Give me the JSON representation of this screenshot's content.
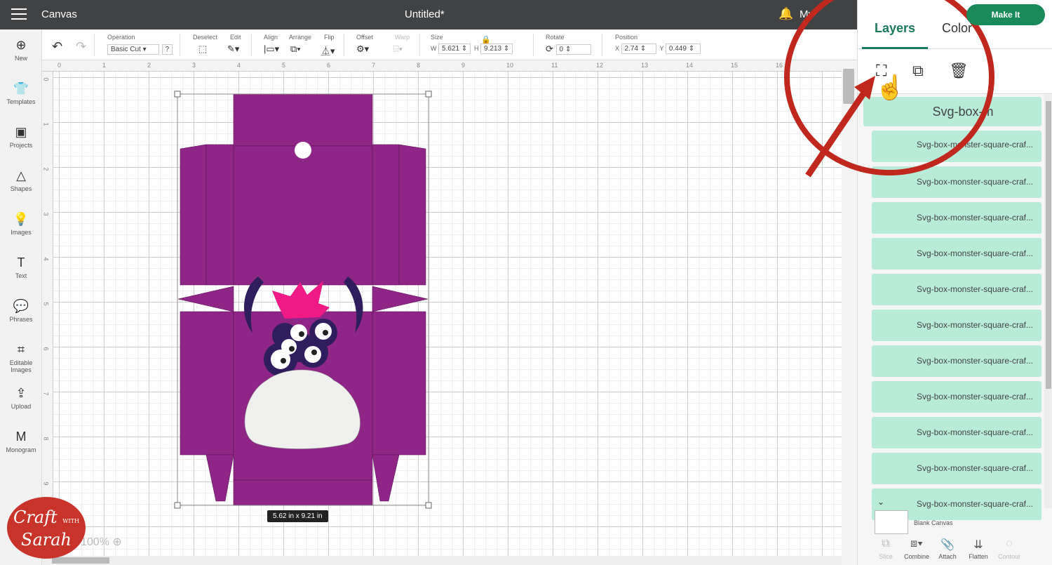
{
  "topbar": {
    "app": "Canvas",
    "title": "Untitled*",
    "my": "My",
    "make_it": "Make It"
  },
  "sidebar": [
    {
      "icon": "⊕",
      "label": "New",
      "name": "new"
    },
    {
      "icon": "👕",
      "label": "Templates",
      "name": "templates"
    },
    {
      "icon": "▣",
      "label": "Projects",
      "name": "projects"
    },
    {
      "icon": "△",
      "label": "Shapes",
      "name": "shapes"
    },
    {
      "icon": "💡",
      "label": "Images",
      "name": "images"
    },
    {
      "icon": "T",
      "label": "Text",
      "name": "text"
    },
    {
      "icon": "💬",
      "label": "Phrases",
      "name": "phrases"
    },
    {
      "icon": "⌗",
      "label": "Editable Images",
      "name": "editable-images"
    },
    {
      "icon": "⇪",
      "label": "Upload",
      "name": "upload"
    },
    {
      "icon": "M",
      "label": "Monogram",
      "name": "monogram"
    }
  ],
  "toolbar": {
    "operation_label": "Operation",
    "operation_value": "Basic Cut",
    "help": "?",
    "deselect": "Deselect",
    "edit": "Edit",
    "align": "Align",
    "arrange": "Arrange",
    "flip": "Flip",
    "offset": "Offset",
    "warp": "Warp",
    "size": "Size",
    "w_label": "W",
    "w": "5.621",
    "h_label": "H",
    "h": "9.213",
    "rotate": "Rotate",
    "rotate_value": "0",
    "position": "Position",
    "x_label": "X",
    "x": "2.74",
    "y_label": "Y",
    "y": "0.449"
  },
  "ruler_h": [
    "0",
    "1",
    "2",
    "3",
    "4",
    "5",
    "6",
    "7",
    "8",
    "9",
    "10",
    "11",
    "12",
    "13",
    "14",
    "15",
    "16"
  ],
  "ruler_v": [
    "0",
    "1",
    "2",
    "3",
    "4",
    "5",
    "6",
    "7",
    "8",
    "9"
  ],
  "size_label": "5.62  in x 9.21  in",
  "zoom": "100%",
  "panel": {
    "tabs": [
      "Layers",
      "Color"
    ],
    "group": "Svg-box-m",
    "layers": [
      "Svg-box-monster-square-craf...",
      "Svg-box-monster-square-craf...",
      "Svg-box-monster-square-craf...",
      "Svg-box-monster-square-craf...",
      "Svg-box-monster-square-craf...",
      "Svg-box-monster-square-craf...",
      "Svg-box-monster-square-craf...",
      "Svg-box-monster-square-craf...",
      "Svg-box-monster-square-craf...",
      "Svg-box-monster-square-craf...",
      "Svg-box-monster-square-craf..."
    ],
    "blank_canvas": "Blank Canvas",
    "bottom": [
      {
        "label": "Slice",
        "icon": "⧉",
        "disabled": true
      },
      {
        "label": "Combine",
        "icon": "⧈▾",
        "disabled": false
      },
      {
        "label": "Attach",
        "icon": "📎",
        "disabled": false
      },
      {
        "label": "Flatten",
        "icon": "⇊",
        "disabled": false
      },
      {
        "label": "Contour",
        "icon": "◌",
        "disabled": true
      }
    ]
  },
  "logo": {
    "line1": "Craft",
    "with": "WITH",
    "line2": "Sarah"
  },
  "colors": {
    "box": "#8e2587",
    "annotation": "#c0281e",
    "accent": "#1a7a55",
    "layer": "#b8ebd8"
  }
}
